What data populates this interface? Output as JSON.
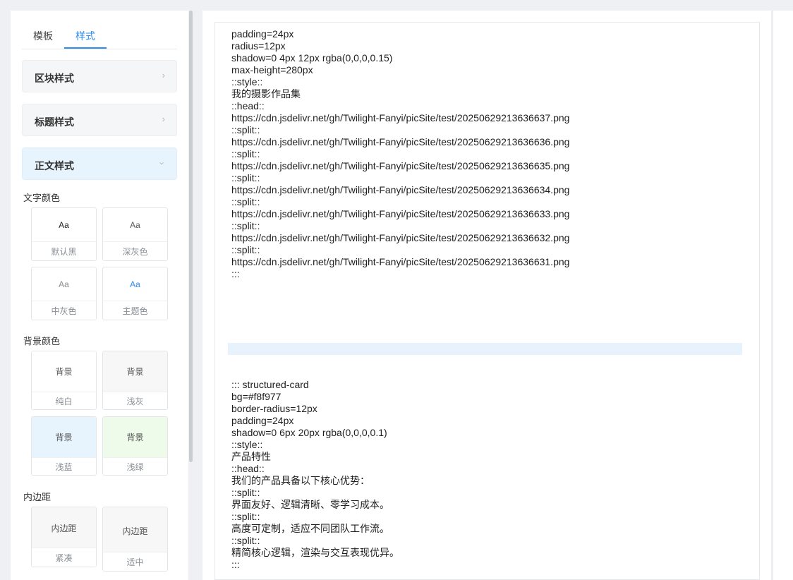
{
  "sidebar": {
    "tabs": [
      "模板",
      "样式"
    ],
    "active_tab": "样式",
    "sections": [
      {
        "label": "区块样式",
        "state": "collapsed"
      },
      {
        "label": "标题样式",
        "state": "collapsed"
      },
      {
        "label": "正文样式",
        "state": "expanded"
      }
    ],
    "text_color": {
      "label": "文字颜色",
      "options": [
        {
          "sample": "Aa",
          "name": "默认黑",
          "color": "#222222"
        },
        {
          "sample": "Aa",
          "name": "深灰色",
          "color": "#555555"
        },
        {
          "sample": "Aa",
          "name": "中灰色",
          "color": "#8c8c8c"
        },
        {
          "sample": "Aa",
          "name": "主题色",
          "color": "#2d8cf0"
        }
      ]
    },
    "bg_color": {
      "label": "背景颜色",
      "options": [
        {
          "sample": "背景",
          "name": "纯白",
          "color": "#ffffff"
        },
        {
          "sample": "背景",
          "name": "浅灰",
          "color": "#f7f7f7"
        },
        {
          "sample": "背景",
          "name": "浅蓝",
          "color": "#e8f4fd"
        },
        {
          "sample": "背景",
          "name": "浅绿",
          "color": "#eefbea"
        }
      ]
    },
    "padding": {
      "label": "内边距",
      "options": [
        {
          "sample": "内边距",
          "name": "紧凑"
        },
        {
          "sample": "内边距",
          "name": "适中"
        }
      ]
    }
  },
  "editor": {
    "lines_top": [
      "padding=24px",
      "radius=12px",
      "shadow=0 4px 12px rgba(0,0,0,0.15)",
      "max-height=280px",
      "::style::",
      "我的摄影作品集",
      "::head::",
      "https://cdn.jsdelivr.net/gh/Twilight-Fanyi/picSite/test/20250629213636637.png",
      "::split::",
      "https://cdn.jsdelivr.net/gh/Twilight-Fanyi/picSite/test/20250629213636636.png",
      "::split::",
      "https://cdn.jsdelivr.net/gh/Twilight-Fanyi/picSite/test/20250629213636635.png",
      "::split::",
      "https://cdn.jsdelivr.net/gh/Twilight-Fanyi/picSite/test/20250629213636634.png",
      "::split::",
      "https://cdn.jsdelivr.net/gh/Twilight-Fanyi/picSite/test/20250629213636633.png",
      "::split::",
      "https://cdn.jsdelivr.net/gh/Twilight-Fanyi/picSite/test/20250629213636632.png",
      "::split::",
      "https://cdn.jsdelivr.net/gh/Twilight-Fanyi/picSite/test/20250629213636631.png",
      ":::"
    ],
    "lines_bottom": [
      "::: structured-card",
      "bg=#f8f977",
      "border-radius=12px",
      "padding=24px",
      "shadow=0 6px 20px rgba(0,0,0,0.1)",
      "::style::",
      "产品特性",
      "::head::",
      "我们的产品具备以下核心优势：",
      "::split::",
      "界面友好、逻辑清晰、零学习成本。",
      "::split::",
      "高度可定制，适应不同团队工作流。",
      "::split::",
      "精简核心逻辑，渲染与交互表现优异。",
      ":::"
    ]
  },
  "colors": {
    "accent": "#2d8cf0",
    "active_section_bg": "#e8f4fd"
  }
}
